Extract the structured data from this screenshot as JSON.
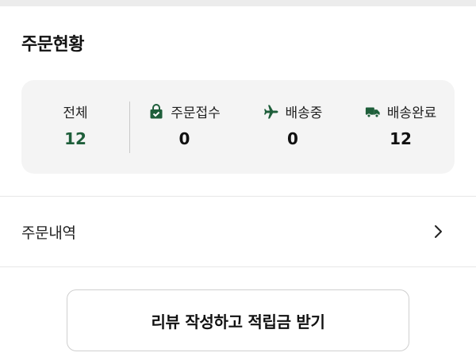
{
  "section": {
    "title": "주문현황"
  },
  "order_status": [
    {
      "label": "전체",
      "value": "12",
      "icon": ""
    },
    {
      "label": "주문접수",
      "value": "0",
      "icon": "shopping-bag-check-icon"
    },
    {
      "label": "배송중",
      "value": "0",
      "icon": "airplane-icon"
    },
    {
      "label": "배송완료",
      "value": "12",
      "icon": "delivery-truck-icon"
    }
  ],
  "menu": {
    "order_history": "주문내역"
  },
  "review_button": {
    "label": "리뷰 작성하고 적립금 받기"
  },
  "colors": {
    "accent": "#1e5e3a",
    "card_bg": "#f4f4f4"
  }
}
